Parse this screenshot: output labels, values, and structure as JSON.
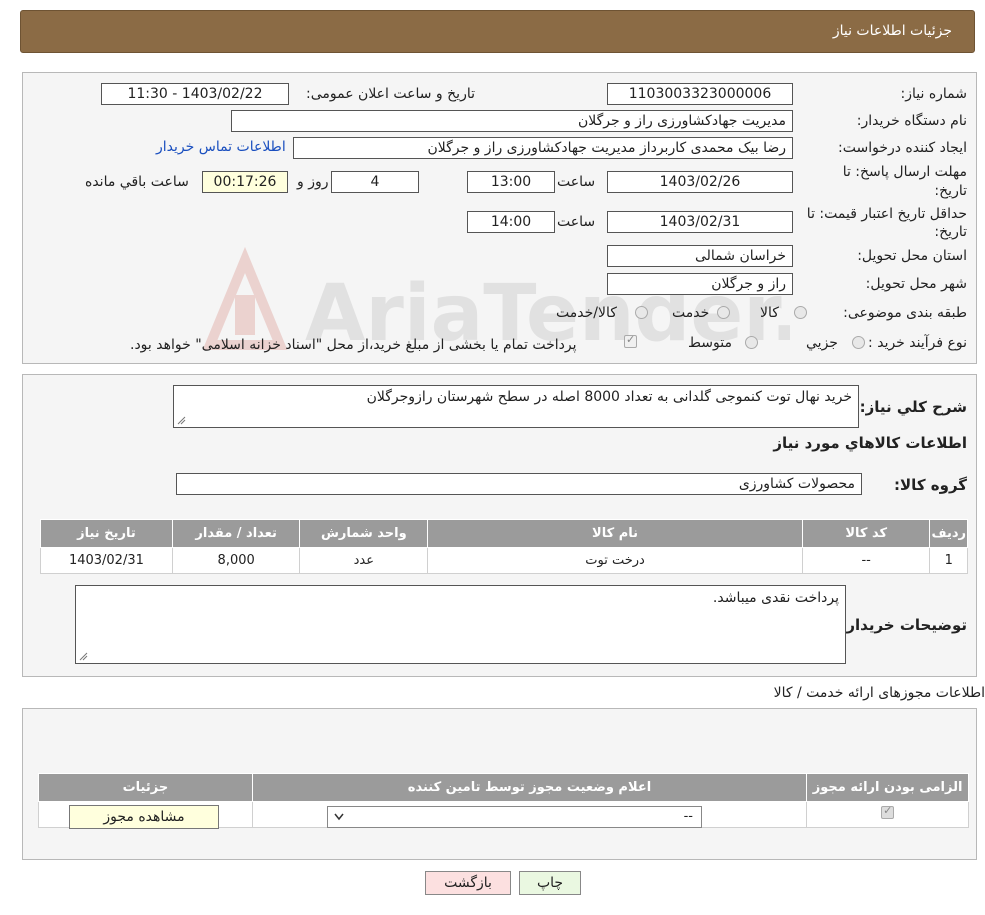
{
  "header": {
    "title": "جزئیات اطلاعات نیاز"
  },
  "form": {
    "need_number_label": "شماره نیاز:",
    "need_number": "1103003323000006",
    "announce_label": "تاریخ و ساعت اعلان عمومی:",
    "announce_value": "1403/02/22 - 11:30",
    "buyer_org_label": "نام دستگاه خریدار:",
    "buyer_org": "مدیریت جهادکشاورزی راز و جرگلان",
    "creator_label": "ایجاد کننده درخواست:",
    "creator": "رضا  بیک محمدی کاربرداز مدیریت جهادکشاورزی راز و جرگلان",
    "contact_link": "اطلاعات تماس خریدار",
    "deadline_label_1": "مهلت ارسال پاسخ: تا",
    "deadline_label_2": "تاریخ:",
    "deadline_date": "1403/02/26",
    "time_label": "ساعت",
    "deadline_time": "13:00",
    "days_value": "4",
    "days_label": "روز و",
    "remaining_time": "00:17:26",
    "remaining_label": "ساعت باقي مانده",
    "validity_label_1": "حداقل تاریخ اعتبار قیمت: تا",
    "validity_label_2": "تاریخ:",
    "validity_date": "1403/02/31",
    "validity_time": "14:00",
    "province_label": "استان محل تحویل:",
    "province": "خراسان شمالی",
    "city_label": "شهر محل تحویل:",
    "city": "راز و جرگلان",
    "category_label": "طبقه بندی موضوعی:",
    "category_options": [
      "کالا",
      "خدمت",
      "کالا/خدمت"
    ],
    "process_label": "نوع فرآیند خرید :",
    "process_options": [
      "جزيي",
      "متوسط"
    ],
    "process_note": "پرداخت تمام یا بخشی از مبلغ خرید،از محل \"اسناد خزانه اسلامی\" خواهد بود."
  },
  "description": {
    "label": "شرح کلي نیاز:",
    "text": "خرید نهال توت کنموجی گلدانی به تعداد 8000 اصله در سطح شهرستان رازوجرگلان"
  },
  "goods": {
    "section_title": "اطلاعات کالاهاي مورد نیاز",
    "group_label": "گروه کالا:",
    "group_value": "محصولات کشاورزی",
    "columns": [
      "ردیف",
      "کد کالا",
      "نام کالا",
      "واحد شمارش",
      "تعداد / مقدار",
      "تاریخ نیاز"
    ],
    "rows": [
      [
        "1",
        "--",
        "درخت توت",
        "عدد",
        "8,000",
        "1403/02/31"
      ]
    ]
  },
  "buyer_notes": {
    "label": "توضیحات خریدار:",
    "text": "پرداخت نقدی میباشد."
  },
  "permits": {
    "section_title": "اطلاعات مجوزهای ارائه خدمت / کالا",
    "columns": [
      "الزامی بودن ارائه مجوز",
      "اعلام وضعیت مجوز توسط تامین کننده",
      "جزئیات"
    ],
    "select_value": "--",
    "view_button": "مشاهده مجوز"
  },
  "actions": {
    "print": "چاپ",
    "back": "بازگشت"
  },
  "watermark": "AriaTender.neT"
}
